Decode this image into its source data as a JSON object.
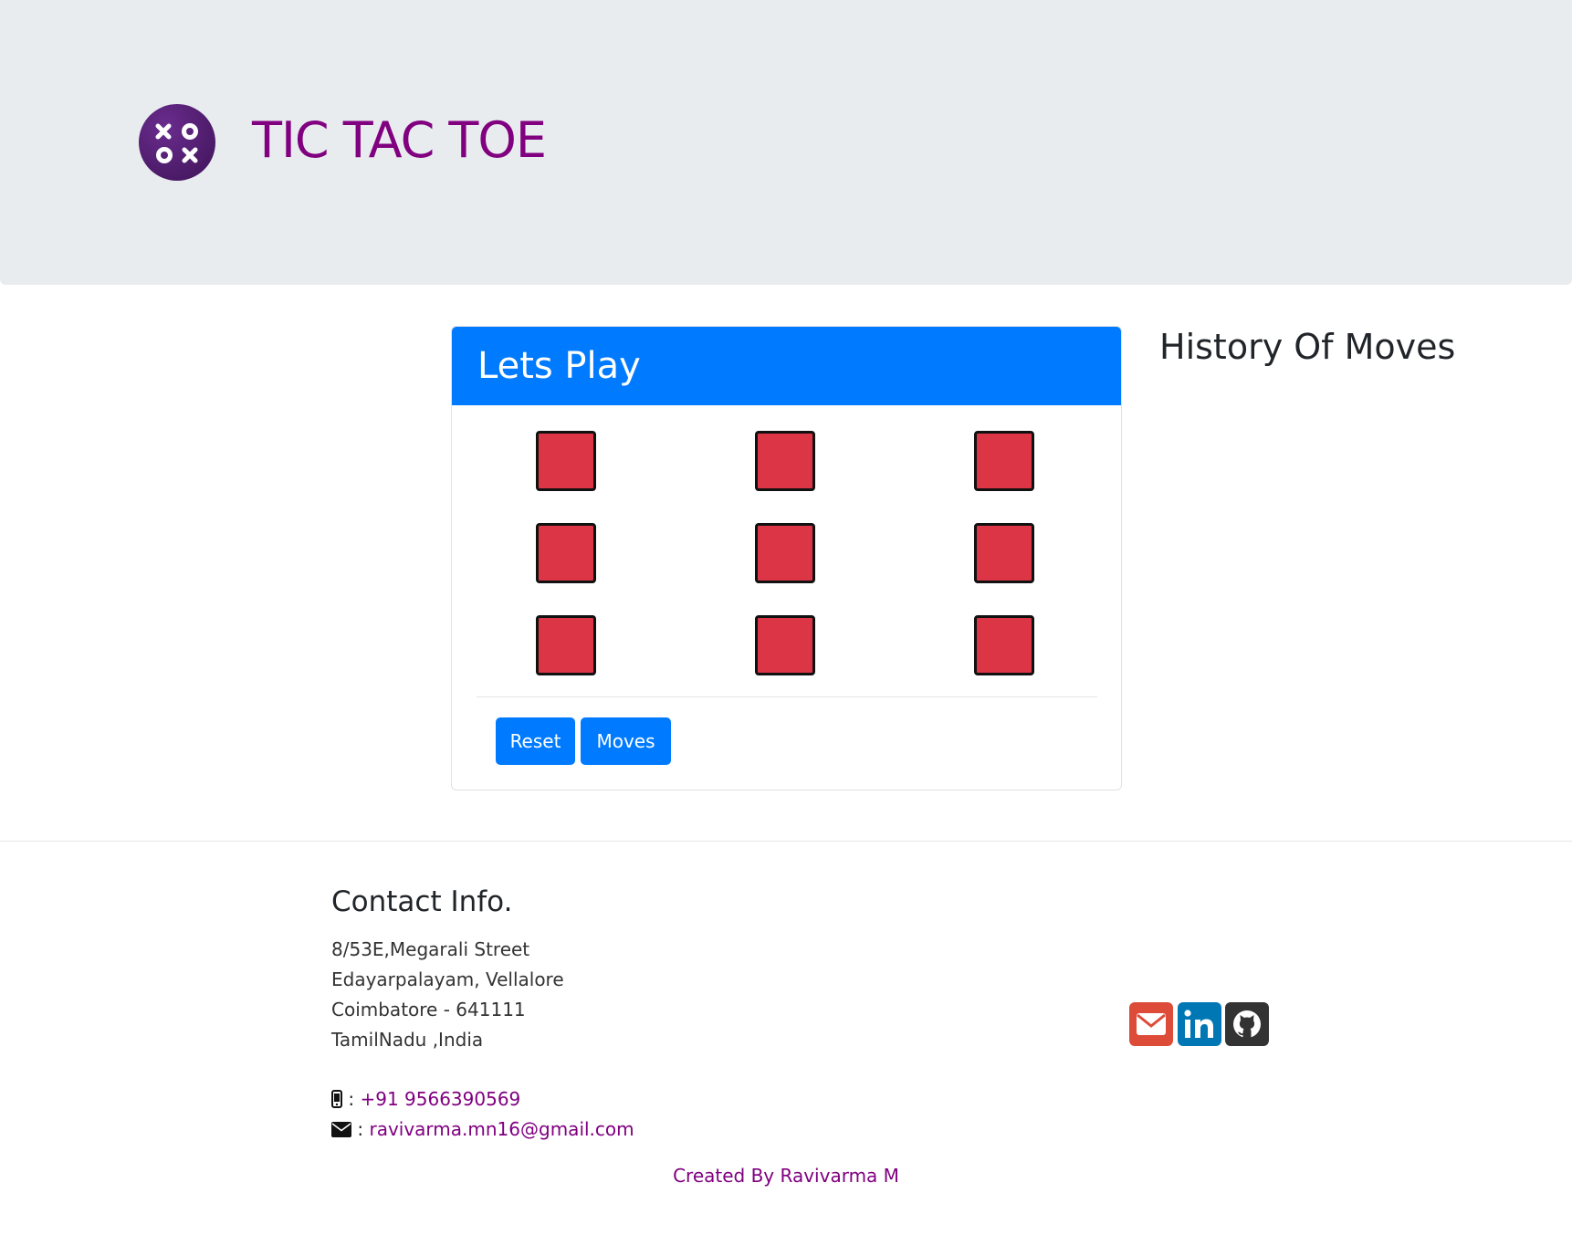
{
  "header": {
    "title": "TIC TAC TOE",
    "logo_icon": "xo-logo-icon"
  },
  "game": {
    "card_title": "Lets Play",
    "board": [
      [
        "",
        "",
        ""
      ],
      [
        "",
        "",
        ""
      ],
      [
        "",
        "",
        ""
      ]
    ],
    "cell_color": "#dc3545",
    "buttons": {
      "reset": "Reset",
      "moves": "Moves"
    }
  },
  "history": {
    "title": "History Of Moves",
    "moves": []
  },
  "contact": {
    "title": "Contact Info.",
    "address": [
      "8/53E,Megarali Street",
      "Edayarpalayam, Vellalore",
      "Coimbatore - 641111",
      "TamilNadu ,India"
    ],
    "phone_sep": ":",
    "phone": "+91 9566390569",
    "email_sep": ":",
    "email": "ravivarma.mn16@gmail.com"
  },
  "social": [
    {
      "icon": "mail-icon",
      "color": "#dd4b39"
    },
    {
      "icon": "linkedin-icon",
      "color": "#0077b5"
    },
    {
      "icon": "github-icon",
      "color": "#333333"
    }
  ],
  "credit": "Created By Ravivarma M",
  "colors": {
    "accent": "#007bff",
    "brand": "#800080",
    "jumbotron": "#e9ecef"
  }
}
